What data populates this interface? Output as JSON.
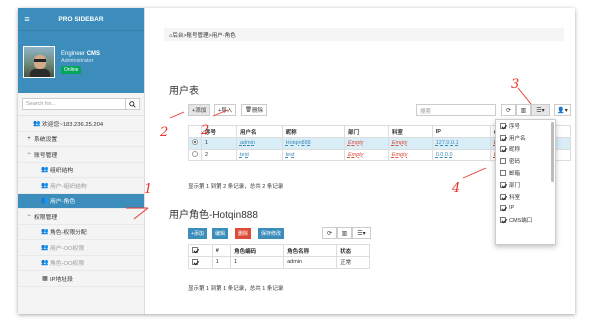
{
  "sidebar": {
    "brand": "PRO SIDEBAR",
    "user_name_first": "Engineer",
    "user_name_bold": "CMS",
    "user_role": "Administrator",
    "status": "Online",
    "search_placeholder": "Search for...",
    "items": [
      {
        "label": "欢迎您~183.236.25.204",
        "level": 1,
        "icon": "person"
      },
      {
        "label": "系统设置",
        "level": 0,
        "icon": "plus"
      },
      {
        "label": "账号管理",
        "level": 0,
        "icon": "minus"
      },
      {
        "label": "组织结构",
        "level": 2,
        "icon": "person"
      },
      {
        "label": "用户-组织结构",
        "level": 2,
        "icon": "person"
      },
      {
        "label": "用户-角色",
        "level": 2,
        "icon": "person"
      },
      {
        "label": "权限管理",
        "level": 0,
        "icon": "minus"
      },
      {
        "label": "角色-权限分配",
        "level": 2,
        "icon": "person"
      },
      {
        "label": "用户-OO权限",
        "level": 2,
        "icon": "person"
      },
      {
        "label": "角色-OO权限",
        "level": 2,
        "icon": "person"
      },
      {
        "label": "IP地址段",
        "level": 2,
        "icon": "grid"
      }
    ]
  },
  "breadcrumb": "后台>账号管理>用户-角色",
  "user_table": {
    "title": "用户表",
    "toolbar": {
      "add": "+添加",
      "import": "+导入",
      "delete": "删除"
    },
    "search_placeholder": "搜索",
    "columns": [
      "序号",
      "用户名",
      "昵称",
      "部门",
      "科室",
      "IP",
      "CMS端口Port"
    ],
    "rows": [
      {
        "no": "1",
        "username": "admin",
        "nickname": "Hotqin888",
        "dept": "Empty",
        "office": "Empty",
        "ip": "127.0.0.1",
        "port": "Empty",
        "selected": true
      },
      {
        "no": "2",
        "username": "test",
        "nickname": "test",
        "dept": "Empty",
        "office": "Empty",
        "ip": "0.0.0.0",
        "port": "Empty",
        "selected": false
      }
    ],
    "page_info": "显示第 1 到第 2 条记录，总共 2 条记录"
  },
  "role_table": {
    "title": "用户角色-Hotqin888",
    "toolbar": {
      "add": "+添加",
      "edit": "编辑",
      "delete": "删除",
      "save": "保存修改"
    },
    "columns": [
      "#",
      "角色编码",
      "角色名称",
      "状态"
    ],
    "rows": [
      {
        "no": "1",
        "code": "1",
        "name": "admin",
        "status": "正常",
        "checked": true
      }
    ],
    "page_info": "显示第 1 到第 1 条记录，总共 1 条记录"
  },
  "columns_dropdown": {
    "items": [
      {
        "label": "序号",
        "checked": true
      },
      {
        "label": "用户名",
        "checked": true
      },
      {
        "label": "昵称",
        "checked": true
      },
      {
        "label": "密码",
        "checked": false
      },
      {
        "label": "邮箱",
        "checked": false
      },
      {
        "label": "部门",
        "checked": true
      },
      {
        "label": "科室",
        "checked": true
      },
      {
        "label": "IP",
        "checked": true
      },
      {
        "label": "CMS端口",
        "checked": true
      }
    ]
  },
  "annotations": [
    "1",
    "2",
    "2",
    "3",
    "4"
  ],
  "colors": {
    "primary": "#3c8dbc",
    "annotation": "#e8332a",
    "empty": "#dd4b39",
    "online": "#00a65a"
  }
}
